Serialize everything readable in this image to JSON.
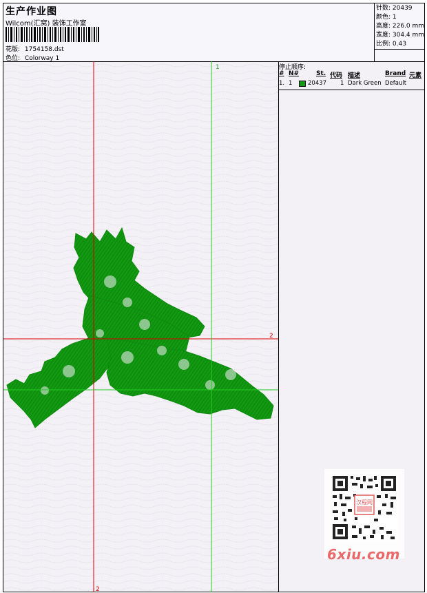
{
  "header": {
    "title": "生产作业图",
    "company": "Wilcom(汇窝) 装饰工作室",
    "pattern_label": "花版:",
    "pattern_value": "1754158.dst",
    "colorway_label": "色位:",
    "colorway_value": "Colorway 1"
  },
  "stats": {
    "stitches": "针数: 20439",
    "colors": "颜色: 1",
    "height": "高度: 226.0 mm",
    "width": "宽度: 304.4 mm",
    "scale": "比例: 0.43"
  },
  "design": {
    "green_axis_label_top": "1",
    "red_axis_label_right": "2",
    "red_axis_label_bottom": "2",
    "thread_color": "#119a11",
    "red_axis_color": "#dd0000",
    "green_axis_color": "#22cc22"
  },
  "stop_sequence": {
    "title": "停止顺序:",
    "columns": [
      "#",
      "N#",
      "St.",
      "代码",
      "描述",
      "Brand",
      "元素"
    ],
    "rows": [
      {
        "num": "1.",
        "needle": "1",
        "stitches": "20437",
        "code": "1",
        "description": "Dark Green",
        "brand": "Default",
        "elements": ""
      }
    ]
  },
  "watermark": {
    "text": "6xiu.com",
    "stamp_text": "汉程网"
  }
}
